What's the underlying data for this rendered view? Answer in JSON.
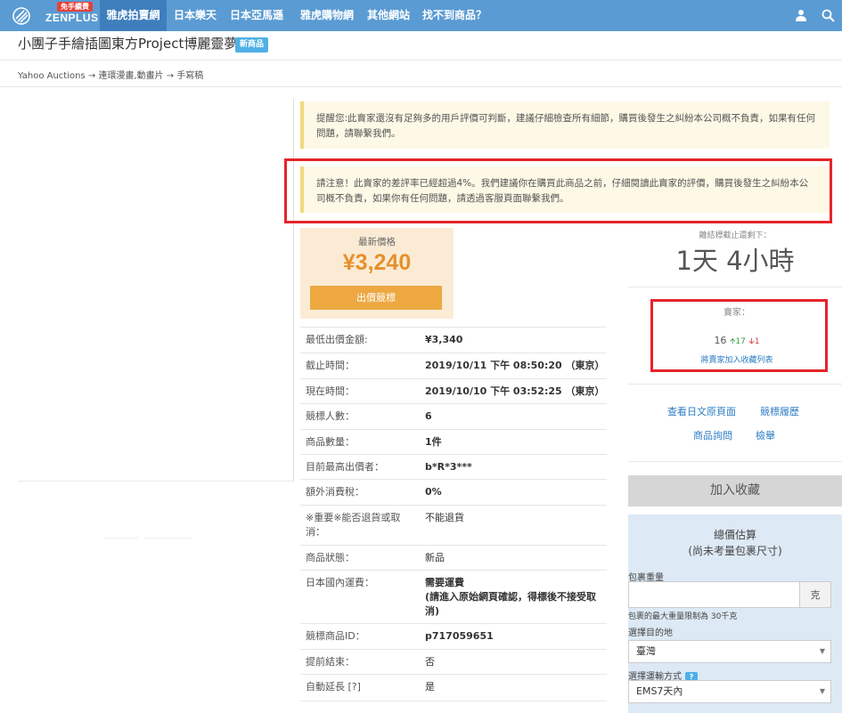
{
  "nav": {
    "logo_badge": "免手續費",
    "logo_text": "ZENPLUS",
    "items": [
      "雅虎拍賣網",
      "日本樂天",
      "日本亞馬遜",
      "雅虎購物網",
      "其他網站",
      "找不到商品？"
    ]
  },
  "product": {
    "title": "小團子手繪插圖東方Project博麗靈夢",
    "badge": "新商品"
  },
  "breadcrumb": "Yahoo Auctions → 連環漫畫,動畫片 → 手寫稿",
  "notices": {
    "first": "提醒您:此賣家還沒有足夠多的用戶評價可判斷，建議仔細檢查所有細節，購買後發生之糾紛本公司概不負責，如果有任何問題，請聯繫我們。",
    "second": "請注意！此賣家的差評率已經超過4%。我們建議你在購買此商品之前，仔細閱讀此賣家的評價，購買後發生之糾紛本公司概不負責，如果你有任何問題，請透過客服頁面聯繫我們。"
  },
  "price": {
    "label": "最新價格",
    "value": "¥3,240",
    "bid_button": "出價競標"
  },
  "details": [
    {
      "k": "最低出價金額:",
      "v": "¥3,340",
      "bold": true
    },
    {
      "k": "截止時間：",
      "v": "2019/10/11 下午 08:50:20 （東京）",
      "bold": true
    },
    {
      "k": "現在時間：",
      "v": "2019/10/10 下午 03:52:25 （東京）",
      "bold": true
    },
    {
      "k": "競標人數：",
      "v": "6",
      "bold": true
    },
    {
      "k": "商品數量：",
      "v": "1件",
      "bold": true
    },
    {
      "k": "目前最高出價者：",
      "v": "b*R*3***",
      "bold": true
    },
    {
      "k": "額外消費稅：",
      "v": "0%",
      "bold": true
    },
    {
      "k": "※重要※能否退貨或取消：",
      "v": "不能退貨",
      "bold": false
    },
    {
      "k": "商品狀態：",
      "v": "新品",
      "bold": false
    },
    {
      "k": "日本國內運費：",
      "v": "需要運費",
      "v2": "(請進入原始網頁確認，得標後不接受取消)",
      "bold": true
    },
    {
      "k": "競標商品ID：",
      "v": "p717059651",
      "bold": true
    },
    {
      "k": "提前結束：",
      "v": "否",
      "bold": false
    },
    {
      "k": "自動延長 [?]",
      "v": "是",
      "bold": false
    }
  ],
  "remaining": {
    "label": "離結標截止還剩下：",
    "value": "1天 4小時"
  },
  "seller": {
    "label": "賣家：",
    "score": "16",
    "positive": "17",
    "negative": "1",
    "add_link": "將賣家加入收藏列表"
  },
  "links": {
    "view_original": "查看日文原頁面",
    "bid_history": "競標履歷",
    "inquiry": "商品詢問",
    "report": "檢舉"
  },
  "favorite_button": "加入收藏",
  "estimate": {
    "title": "總價估算",
    "subtitle": "(尚未考量包裹尺寸)",
    "weight_label": "包裹重量",
    "weight_unit": "克",
    "weight_note": "包裹的最大重量限制為 30千克",
    "dest_label": "選擇目的地",
    "dest_value": "臺灣",
    "ship_label": "選擇運輸方式",
    "ship_help": "?",
    "ship_value": "EMS7天內"
  },
  "colors": {
    "nav": "#5a9bd3",
    "nav_active": "#3f7ebd",
    "price": "#e5912b",
    "alert_border": "#e5242b",
    "link": "#2c7cc4"
  }
}
